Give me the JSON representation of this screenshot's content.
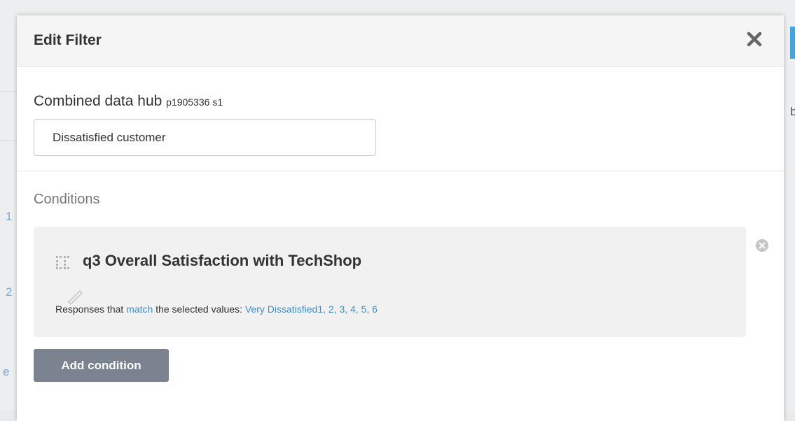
{
  "modal": {
    "title": "Edit Filter",
    "close_icon": "close-icon"
  },
  "source": {
    "name": "Combined data hub",
    "id": "p1905336 s1"
  },
  "filter_name": {
    "value": "Dissatisfied customer"
  },
  "conditions": {
    "label": "Conditions",
    "items": [
      {
        "icon": "grid-icon",
        "title": "q3 Overall Satisfaction with TechShop",
        "desc_prefix": "Responses that",
        "desc_match": "match",
        "desc_middle": "the selected values:",
        "values_text": "Very Dissatisfied1, 2, 3, 4, 5, 6"
      }
    ]
  },
  "add_condition_label": "Add condition",
  "background": {
    "fragments": [
      "1",
      "2",
      "e"
    ],
    "right_letter": "b"
  },
  "colors": {
    "link": "#3d8fce",
    "button": "#7b8390",
    "accent": "#4aa3d8"
  }
}
